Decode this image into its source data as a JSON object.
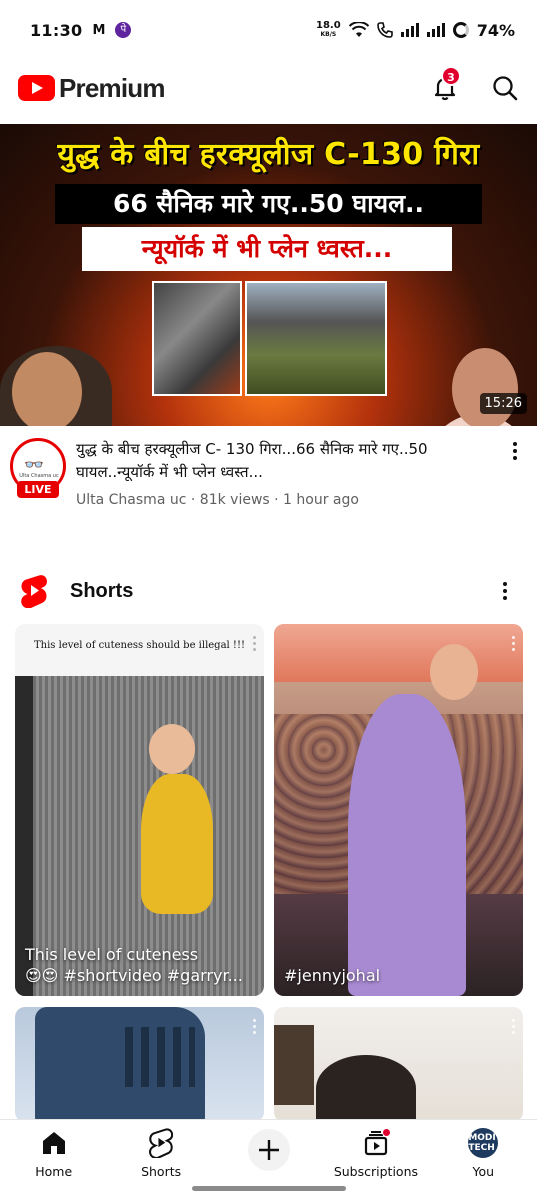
{
  "status_bar": {
    "time": "11:30",
    "mail_glyph": "M",
    "pe_glyph": "पे",
    "net_speed": "18.0",
    "net_unit": "KB/S",
    "battery": "74%"
  },
  "header": {
    "logo_text": "Premium",
    "notification_count": "3",
    "brand_color": "#ff0000"
  },
  "video": {
    "thumb_line1": "युद्ध के बीच हरक्यूलीज C-130 गिरा",
    "thumb_line2": "66 सैनिक मारे गए..50 घायल..",
    "thumb_line3": "न्यूयॉर्क में भी प्लेन ध्वस्त...",
    "duration": "15:26",
    "title": "युद्ध के बीच हरक्यूलीज C- 130 गिरा...66 सैनिक मारे गए..50 घायल..न्यूयॉर्क में भी प्लेन ध्वस्त...",
    "channel": "Ulta Chasma uc",
    "views": "81k views",
    "age": "1 hour ago",
    "separator": " · ",
    "avatar_glyph": "👓",
    "avatar_brand": "Ulta Chasma uc",
    "live_label": "LIVE"
  },
  "shorts": {
    "section_title": "Shorts",
    "items": [
      {
        "caption_top": "This level of cuteness should be illegal !!!",
        "label_line1": "This level of cuteness",
        "label_line2": "😍😍 #shortvideo #garryr..."
      },
      {
        "label_line1": "#jennyjohal"
      }
    ]
  },
  "bottom_nav": {
    "home": "Home",
    "shorts": "Shorts",
    "subscriptions": "Subscriptions",
    "you": "You",
    "you_avatar_text": "MODI TECH"
  }
}
